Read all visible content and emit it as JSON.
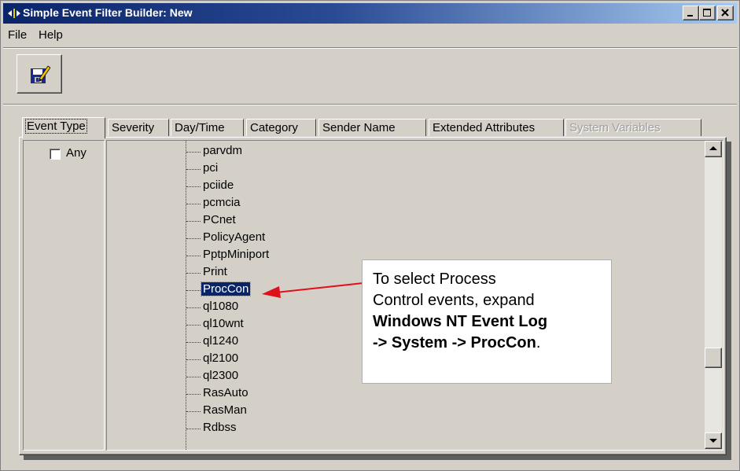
{
  "window": {
    "title": "Simple Event Filter Builder: New",
    "controls": [
      "minimize",
      "maximize",
      "close"
    ]
  },
  "menu": [
    "File",
    "Help"
  ],
  "toolbar": {
    "save_icon": "save-edit-icon"
  },
  "tabs": [
    {
      "label": "Event Type",
      "active": true,
      "enabled": true
    },
    {
      "label": "Severity",
      "active": false,
      "enabled": true
    },
    {
      "label": "Day/Time",
      "active": false,
      "enabled": true
    },
    {
      "label": "Category",
      "active": false,
      "enabled": true
    },
    {
      "label": "Sender Name",
      "active": false,
      "enabled": true
    },
    {
      "label": "Extended Attributes",
      "active": false,
      "enabled": true
    },
    {
      "label": "System Variables",
      "active": false,
      "enabled": false
    }
  ],
  "filter": {
    "any_label": "Any",
    "any_checked": false
  },
  "tree": {
    "items": [
      "parvdm",
      "pci",
      "pciide",
      "pcmcia",
      "PCnet",
      "PolicyAgent",
      "PptpMiniport",
      "Print",
      "ProcCon",
      "ql1080",
      "ql10wnt",
      "ql1240",
      "ql2100",
      "ql2300",
      "RasAuto",
      "RasMan",
      "Rdbss"
    ],
    "selected": "ProcCon"
  },
  "callout": {
    "line1": "To select Process",
    "line2": "Control events, expand",
    "line3": "Windows NT Event Log",
    "line4_bold": "-> System -> ProcCon",
    "line4_end": "."
  },
  "colors": {
    "title_bar": "#0a246a",
    "selection": "#0a246a",
    "arrow": "#e0101a",
    "face": "#d4d0c8"
  }
}
